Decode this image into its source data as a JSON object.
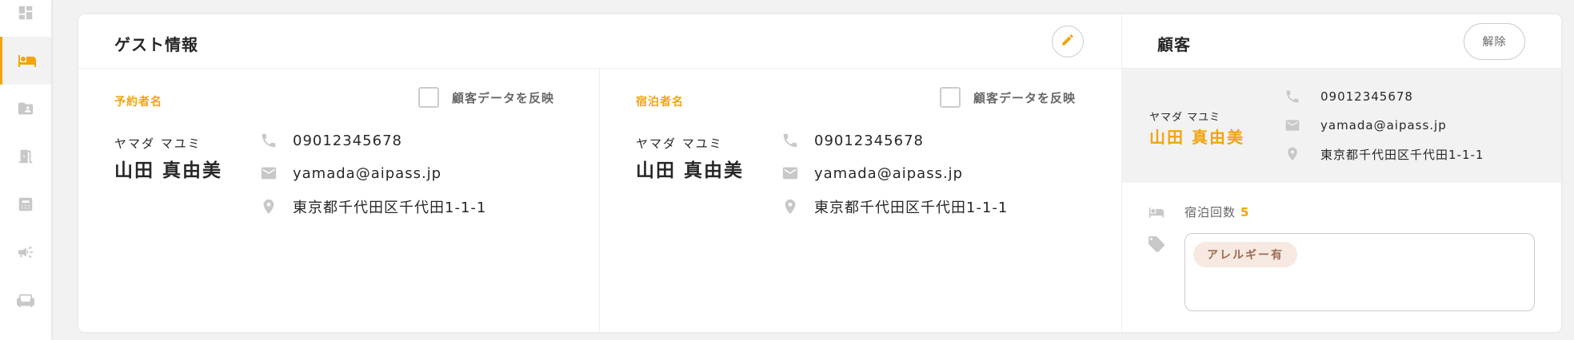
{
  "sidebar": {
    "items": [
      {
        "icon": "dashboard-icon"
      },
      {
        "icon": "bed-icon",
        "active": true
      },
      {
        "icon": "folder-user-icon"
      },
      {
        "icon": "door-icon"
      },
      {
        "icon": "calculator-icon"
      },
      {
        "icon": "megaphone-icon"
      },
      {
        "icon": "armchair-icon"
      }
    ]
  },
  "guest_info": {
    "title": "ゲスト情報",
    "edit_icon": "pencil-icon",
    "booker": {
      "label": "予約者名",
      "checkbox_label": "顧客データを反映",
      "kana": "ヤマダ マユミ",
      "name": "山田 真由美",
      "phone": "09012345678",
      "email": "yamada@aipass.jp",
      "address": "東京都千代田区千代田1-1-1"
    },
    "guest": {
      "label": "宿泊者名",
      "checkbox_label": "顧客データを反映",
      "kana": "ヤマダ マユミ",
      "name": "山田 真由美",
      "phone": "09012345678",
      "email": "yamada@aipass.jp",
      "address": "東京都千代田区千代田1-1-1"
    }
  },
  "customer": {
    "title": "顧客",
    "release_label": "解除",
    "kana": "ヤマダ マユミ",
    "name": "山田 真由美",
    "phone": "09012345678",
    "email": "yamada@aipass.jp",
    "address": "東京都千代田区千代田1-1-1",
    "stay_label": "宿泊回数",
    "stay_count": "5",
    "tags": [
      "アレルギー有"
    ]
  },
  "colors": {
    "accent": "#f2a40e",
    "icon_gray": "#c8c8c8",
    "tag_bg": "#f7e9e1",
    "tag_text": "#9c6b53"
  }
}
